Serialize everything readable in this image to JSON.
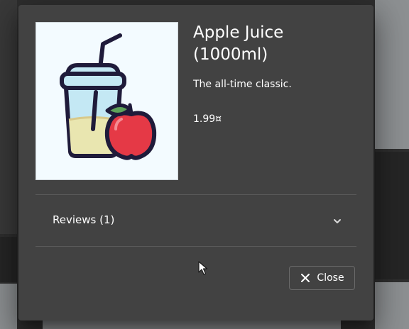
{
  "product": {
    "name": "Apple Juice (1000ml)",
    "description": "The all-time classic.",
    "price": "1.99¤",
    "image_icon": "apple-juice-cup-icon"
  },
  "reviews": {
    "label": "Reviews (1)",
    "expand_icon": "chevron-down-icon"
  },
  "actions": {
    "close_label": "Close",
    "close_icon": "close-icon"
  },
  "colors": {
    "dialog_background": "#424242",
    "text": "#ffffff",
    "image_background": "#f3fbff"
  }
}
